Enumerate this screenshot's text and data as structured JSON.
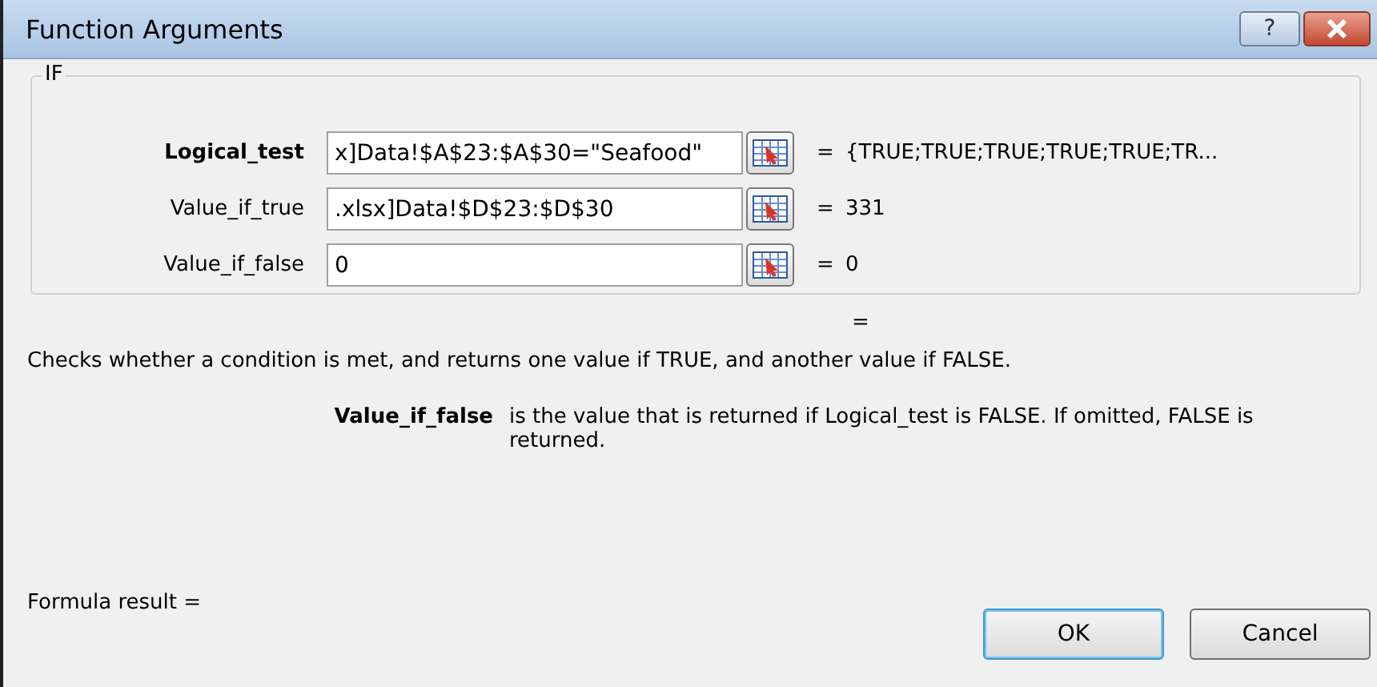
{
  "window": {
    "title": "Function Arguments",
    "help_button": "?"
  },
  "group": {
    "title": "IF",
    "arguments": [
      {
        "name": "Logical_test",
        "required": true,
        "value": "x]Data!$A$23:$A$30=\"Seafood\"",
        "equals": "=",
        "result": "{TRUE;TRUE;TRUE;TRUE;TRUE;TR..."
      },
      {
        "name": "Value_if_true",
        "required": false,
        "value": ".xlsx]Data!$D$23:$D$30",
        "equals": "=",
        "result": "331"
      },
      {
        "name": "Value_if_false",
        "required": false,
        "value": "0",
        "equals": "=",
        "result": "0"
      }
    ]
  },
  "total_equals": "=",
  "description": "Checks whether a condition is met, and returns one value if TRUE, and another value if FALSE.",
  "argument_help": {
    "name": "Value_if_false",
    "text": "is the value that is returned if Logical_test is FALSE. If omitted, FALSE is returned."
  },
  "formula_result": "Formula result =",
  "buttons": [
    {
      "label": "OK",
      "default": true
    },
    {
      "label": "Cancel",
      "default": false
    }
  ]
}
